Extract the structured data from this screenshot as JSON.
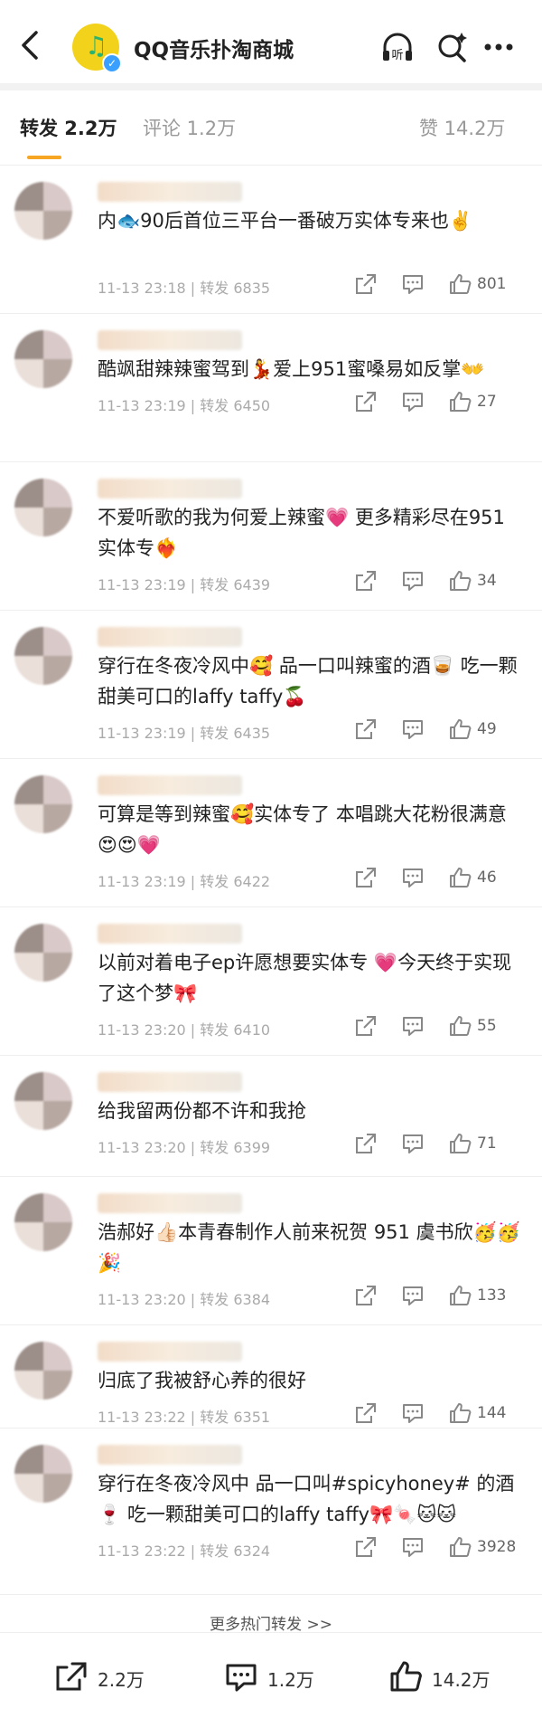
{
  "header": {
    "title": "QQ音乐扑淘商城"
  },
  "tabs": {
    "repost": "转发 2.2万",
    "comment": "评论 1.2万",
    "like": "赞 14.2万"
  },
  "comments": [
    {
      "text": "内🐟90后首位三平台一番破万实体专来也✌️",
      "time": "11-13 23:18 | 转发 6835",
      "likes": "801"
    },
    {
      "text": "酷飒甜辣辣蜜驾到💃爱上951蜜嗓易如反掌👐",
      "time": "11-13 23:19 | 转发 6450",
      "likes": "27"
    },
    {
      "text": "不爱听歌的我为何爱上辣蜜💗 更多精彩尽在951实体专❤️‍🔥",
      "time": "11-13 23:19 | 转发 6439",
      "likes": "34"
    },
    {
      "text": "穿行在冬夜冷风中🥰 品一口叫辣蜜的酒🥃 吃一颗甜美可口的laffy taffy🍒",
      "time": "11-13 23:19 | 转发 6435",
      "likes": "49"
    },
    {
      "text": "可算是等到辣蜜🥰实体专了 本唱跳大花粉很满意😍😍💗",
      "time": "11-13 23:19 | 转发 6422",
      "likes": "46"
    },
    {
      "text": "以前对着电子ep许愿想要实体专 💗今天终于实现了这个梦🎀",
      "time": "11-13 23:20 | 转发 6410",
      "likes": "55"
    },
    {
      "text": "给我留两份都不许和我抢",
      "time": "11-13 23:20 | 转发 6399",
      "likes": "71"
    },
    {
      "text": "浩郝好👍🏻本青春制作人前来祝贺 951 虞书欣🥳🥳🎉",
      "time": "11-13 23:20 | 转发 6384",
      "likes": "133"
    },
    {
      "text": "归底了我被舒心养的很好",
      "time": "11-13 23:22 | 转发 6351",
      "likes": "144"
    },
    {
      "text": "穿行在冬夜冷风中 品一口叫#spicyhoney# 的酒🍷 吃一颗甜美可口的laffy taffy🎀🍬🐱🐱",
      "time": "11-13 23:22 | 转发 6324",
      "likes": "3928"
    }
  ],
  "more_link": "更多热门转发 >>",
  "footer": {
    "repost": "2.2万",
    "comment": "1.2万",
    "like": "14.2万"
  }
}
